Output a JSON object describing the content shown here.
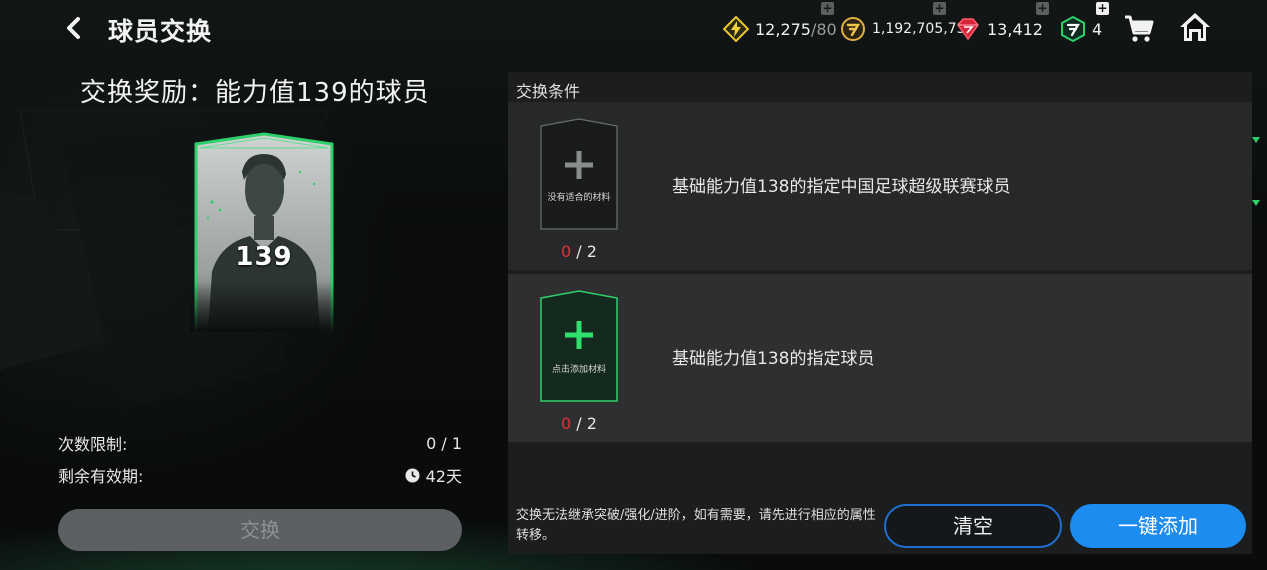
{
  "header": {
    "title": "球员交换",
    "currencies": {
      "energy": {
        "value": "12,275",
        "max": "/80"
      },
      "coins": {
        "value": "1,192,705,731"
      },
      "gems": {
        "value": "13,412"
      },
      "tokens": {
        "value": "4"
      }
    },
    "icons": [
      "chevron-left-icon",
      "energy-icon",
      "coin-icon",
      "gem-icon",
      "token-icon",
      "cart-icon",
      "home-icon"
    ]
  },
  "reward": {
    "title": "交换奖励：能力值139的球员",
    "card_rating": "139"
  },
  "limits": {
    "count_label": "次数限制:",
    "count_value": "0 / 1",
    "expiry_label": "剩余有效期:",
    "expiry_value": "42天"
  },
  "exchange_button": "交换",
  "conditions": {
    "header": "交换条件",
    "rows": [
      {
        "slot_label": "没有适合的材料",
        "owned": "0",
        "required": " / 2",
        "description": "基础能力值138的指定中国足球超级联赛球员"
      },
      {
        "slot_label": "点击添加材料",
        "owned": "0",
        "required": " / 2",
        "description": "基础能力值138的指定球员"
      }
    ]
  },
  "notice": "交换无法继承突破/强化/进阶，如有需要，请先进行相应的属性转移。",
  "buttons": {
    "clear": "清空",
    "add_all": "一键添加"
  },
  "colors": {
    "accent_green": "#2fd06a",
    "primary_blue": "#1d8cf0",
    "count_red": "#e0303a"
  }
}
